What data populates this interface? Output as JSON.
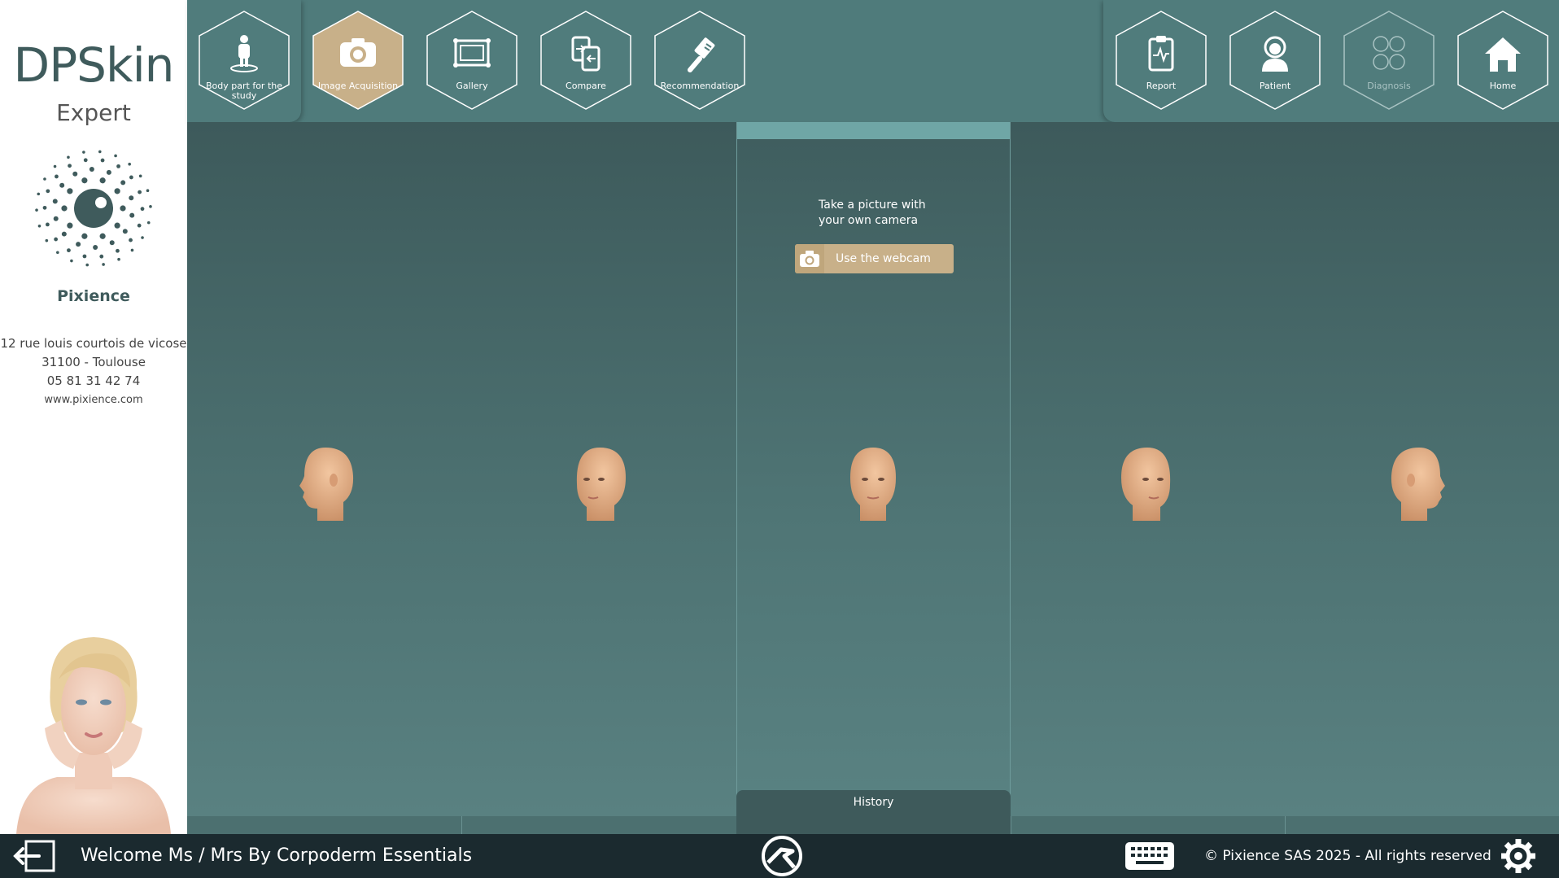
{
  "sidebar": {
    "brand": "DPSkin",
    "brand_sub": "Expert",
    "company": "Pixience",
    "address_line1": "12 rue louis courtois de vicose",
    "address_line2": "31100  -  Toulouse",
    "phone": "05 81 31 42 74",
    "website": "www.pixience.com"
  },
  "toolbar": {
    "left": [
      {
        "label": "Body part for the study",
        "icon": "body-part-icon",
        "active": false
      },
      {
        "label": "Image Acquisition",
        "icon": "camera-icon",
        "active": true
      },
      {
        "label": "Gallery",
        "icon": "gallery-icon",
        "active": false
      },
      {
        "label": "Compare",
        "icon": "compare-icon",
        "active": false
      },
      {
        "label": "Recommendation",
        "icon": "recommendation-icon",
        "active": false
      }
    ],
    "right": [
      {
        "label": "Report",
        "icon": "report-icon",
        "enabled": true
      },
      {
        "label": "Patient",
        "icon": "patient-icon",
        "enabled": true
      },
      {
        "label": "Diagnosis",
        "icon": "diagnosis-icon",
        "enabled": false
      },
      {
        "label": "Home",
        "icon": "home-icon",
        "enabled": true
      }
    ]
  },
  "acquisition": {
    "camera_text_line1": "Take a picture with",
    "camera_text_line2": "your own camera",
    "webcam_button": "Use the webcam",
    "history_tab": "History",
    "head_views": [
      "left-profile",
      "left-three-quarter",
      "front",
      "right-three-quarter",
      "right-profile"
    ]
  },
  "footer": {
    "welcome": "Welcome Ms / Mrs By Corpoderm Essentials",
    "copyright": "© Pixience SAS 2025 - All rights reserved"
  },
  "colors": {
    "accent": "#c8b089",
    "panel": "#507c7c",
    "footer": "#1b2a2f",
    "brand_text": "#3f5b5c"
  }
}
